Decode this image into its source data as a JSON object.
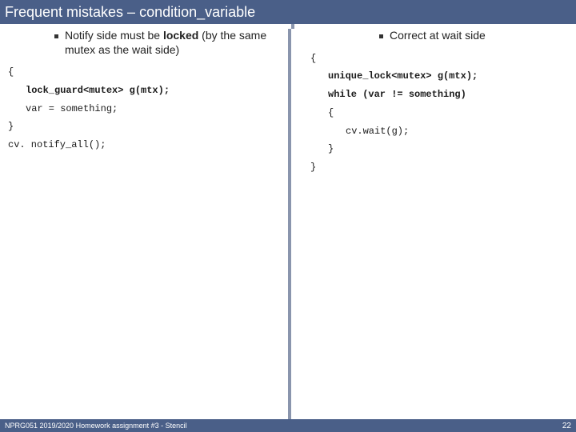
{
  "title": "Frequent mistakes – condition_variable",
  "left": {
    "bullet": "Notify side must be locked (by the same mutex as the wait side)",
    "code": {
      "l1": "{",
      "l2": "lock_guard<mutex> g(mtx);",
      "l3": "var = something;",
      "l4": "}",
      "l5": "cv. notify_all();"
    }
  },
  "right": {
    "bullet": "Correct at wait side",
    "code": {
      "l1": "{",
      "l2": "unique_lock<mutex> g(mtx);",
      "l3": "while (var != something)",
      "l4": "{",
      "l5": "cv.wait(g);",
      "l6": "}",
      "l7": "}"
    }
  },
  "footer": {
    "left": "NPRG051 2019/2020 Homework assignment #3 - Stencil",
    "page": "22"
  }
}
